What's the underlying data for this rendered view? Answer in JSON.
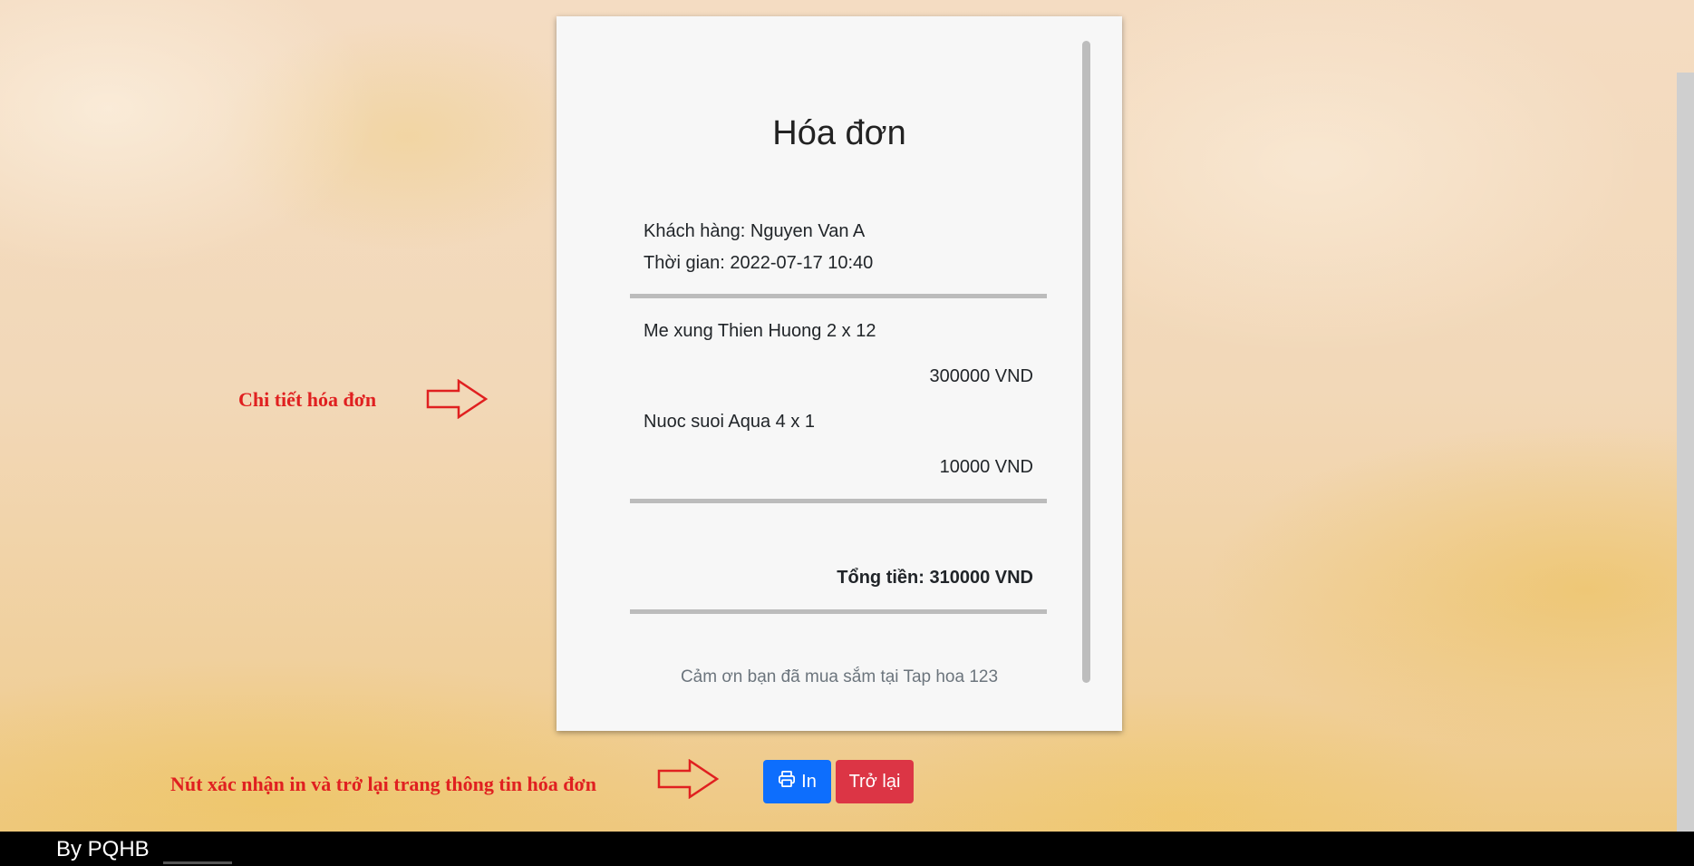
{
  "receipt": {
    "title": "Hóa đơn",
    "customer": "Khách hàng: Nguyen Van A",
    "time": "Thời gian: 2022-07-17 10:40",
    "items": [
      {
        "name": "Me xung Thien Huong 2 x 12",
        "price": "300000 VND"
      },
      {
        "name": "Nuoc suoi Aqua 4 x 1",
        "price": "10000 VND"
      }
    ],
    "total": "Tổng tiền: 310000 VND",
    "thanks": "Cảm ơn bạn đã mua sắm tại Tap hoa 123"
  },
  "buttons": {
    "print_label": "In",
    "back_label": "Trở lại"
  },
  "annotations": {
    "detail": "Chi tiết hóa đơn",
    "buttons": "Nút xác nhận in và trở lại trang thông tin hóa đơn"
  },
  "footer": {
    "text": "By PQHB"
  },
  "colors": {
    "print_button": "#0d6efd",
    "back_button": "#dc3545",
    "annotation": "#e02020"
  },
  "icons": {
    "print": "printer-icon",
    "arrow": "right-arrow-icon"
  }
}
